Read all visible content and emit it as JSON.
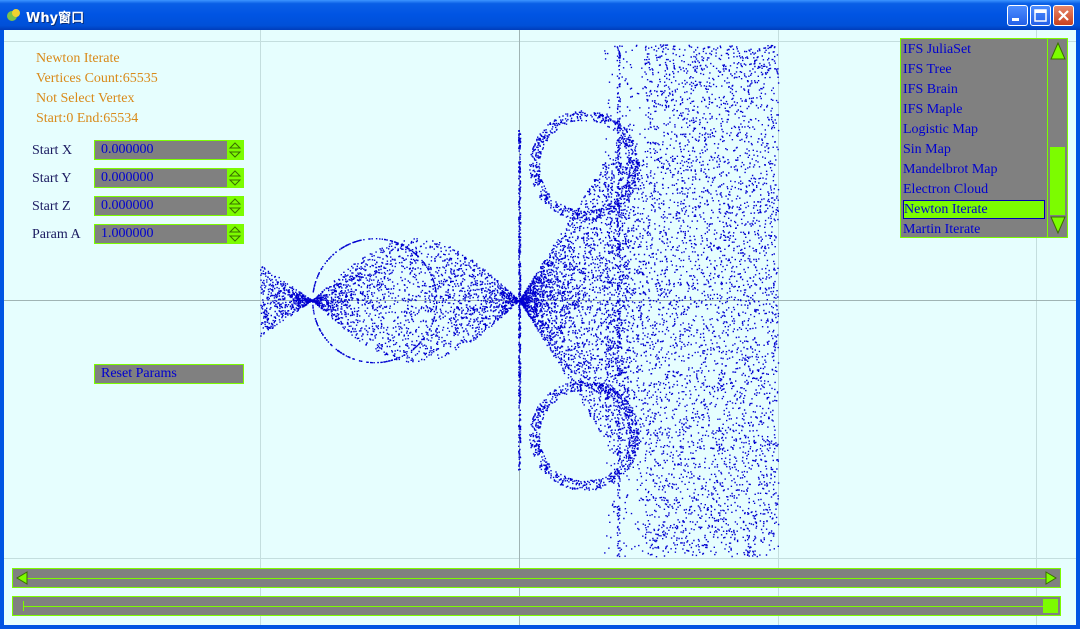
{
  "window": {
    "title": "Why窗口"
  },
  "info": {
    "fractal_name": "Newton Iterate",
    "vertices_count": "Vertices Count:65535",
    "selection": "Not Select Vertex",
    "range": "Start:0 End:65534"
  },
  "params": [
    {
      "label": "Start X",
      "value": "0.000000"
    },
    {
      "label": "Start Y",
      "value": "0.000000"
    },
    {
      "label": "Start Z",
      "value": "0.000000"
    },
    {
      "label": "Param A",
      "value": "1.000000"
    }
  ],
  "reset_label": "Reset Params",
  "fractal_list": {
    "items": [
      "IFS JuliaSet",
      "IFS Tree",
      "IFS Brain",
      "IFS Maple",
      "Logistic Map",
      "Sin Map",
      "Mandelbrot Map",
      "Electron Cloud",
      "Newton Iterate",
      "Martin Iterate"
    ],
    "selected": "Newton Iterate"
  },
  "colors": {
    "point": "#0000d0",
    "accent": "#7cfc00",
    "background": "#e6fefe"
  }
}
